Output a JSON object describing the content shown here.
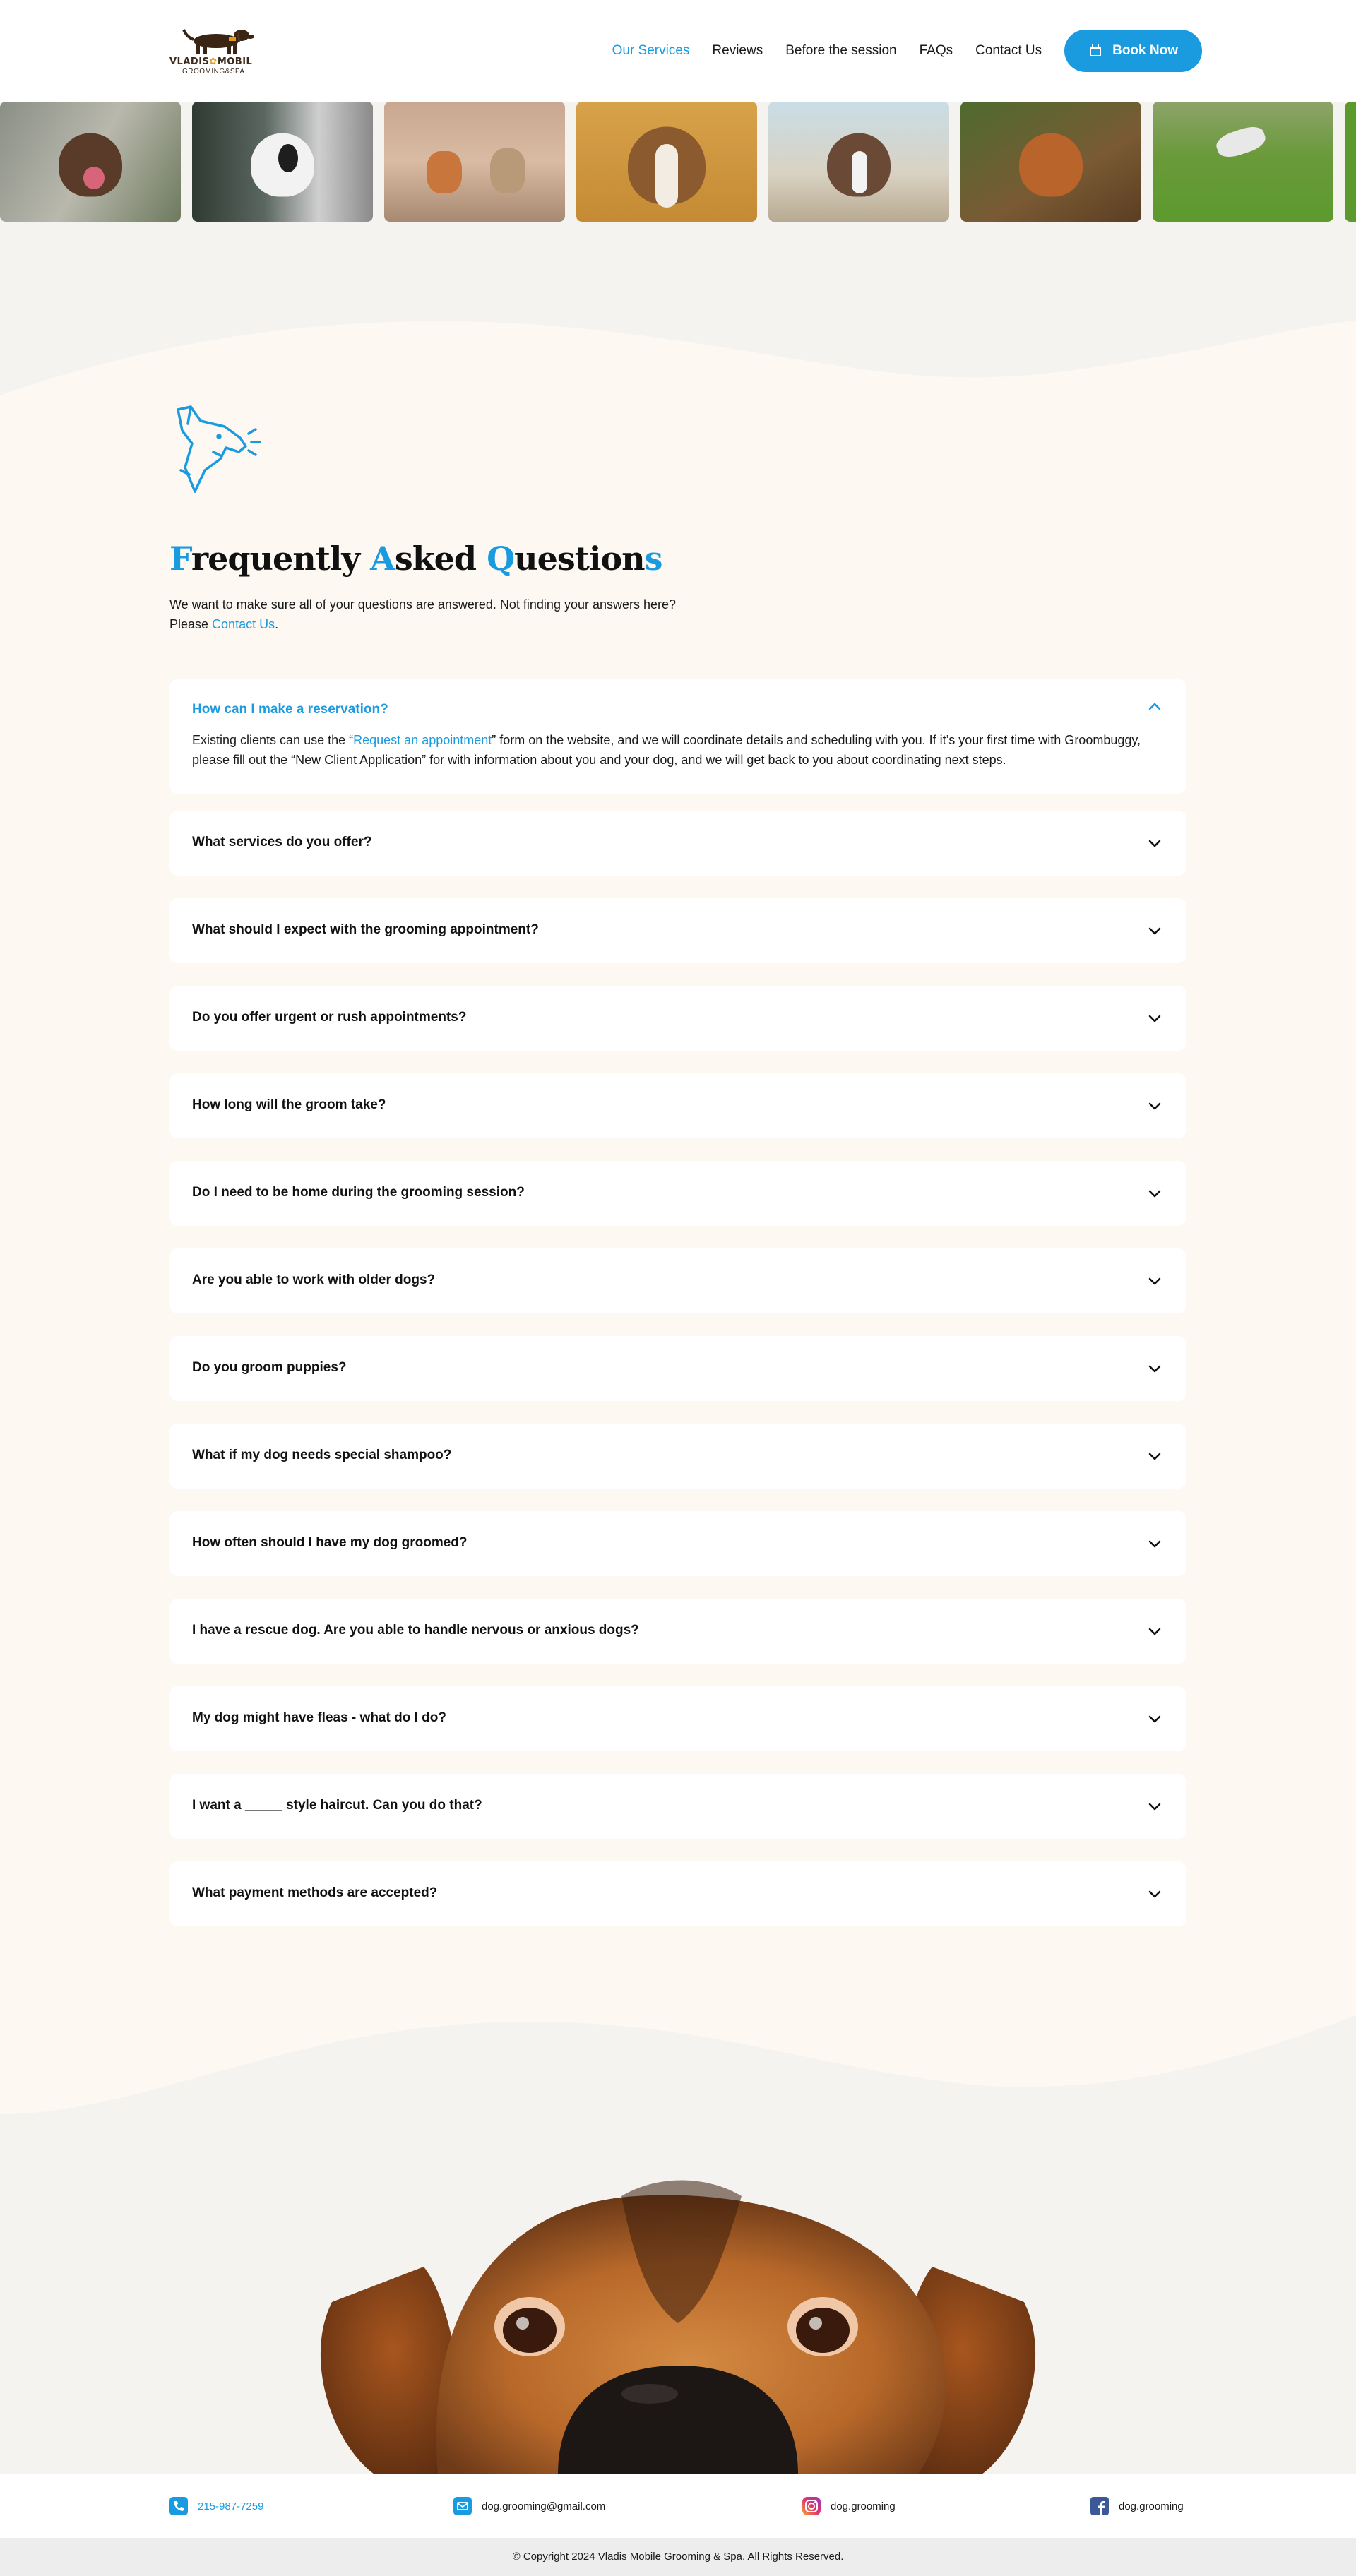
{
  "header": {
    "logo_line1": "VLADIS",
    "logo_star": "✿",
    "logo_line1b": "MOBIL",
    "logo_line2": "GROOMING&SPA",
    "nav": [
      {
        "label": "Our Services",
        "active": true
      },
      {
        "label": "Reviews",
        "active": false
      },
      {
        "label": "Before the session",
        "active": false
      },
      {
        "label": "FAQs",
        "active": false
      },
      {
        "label": "Contact Us",
        "active": false
      }
    ],
    "book_label": "Book Now"
  },
  "colors": {
    "accent": "#1a9be0",
    "cream": "#fdf8f2",
    "gray_bg": "#f5f3f0"
  },
  "faq": {
    "title_parts": [
      {
        "text": "F",
        "hl": true
      },
      {
        "text": "requently ",
        "hl": false
      },
      {
        "text": "A",
        "hl": true
      },
      {
        "text": "sked ",
        "hl": false
      },
      {
        "text": "Q",
        "hl": true
      },
      {
        "text": "uestion",
        "hl": false
      },
      {
        "text": "s",
        "hl": true
      }
    ],
    "intro_line1": "We want to make sure all of your questions are answered. Not finding your answers here?",
    "intro_please": "Please ",
    "intro_link": "Contact Us",
    "intro_end": ".",
    "open_answer": {
      "before": "Existing clients can use the “",
      "link": "Request an appointment",
      "after": "” form on the website, and we will coordinate details and scheduling with you. If it’s your first time with Groombuggy, please fill out the “New Client Application” for with information about you and your dog, and we will get back to you about coordinating next steps."
    },
    "items": [
      "How can I make a reservation?",
      "What services do you offer?",
      "What should I expect with the grooming appointment?",
      "Do you offer urgent or rush appointments?",
      "How long will the groom take?",
      "Do I need to be home during the grooming session?",
      "Are you able to work with older dogs?",
      "Do you groom puppies?",
      "What if my dog needs special shampoo?",
      "How often should I have my dog groomed?",
      "I have a rescue dog. Are you able to handle nervous or anxious dogs?",
      "My dog might have fleas - what do I do?",
      "I want a _____ style haircut. Can you do that?",
      "What payment methods are accepted?"
    ]
  },
  "footer": {
    "phone": "215-987-7259",
    "email": "dog.grooming@gmail.com",
    "instagram": "dog.grooming",
    "facebook": "dog.grooming",
    "copyright": "© Copyright 2024 Vladis Mobile Grooming & Spa. All Rights Reserved."
  }
}
